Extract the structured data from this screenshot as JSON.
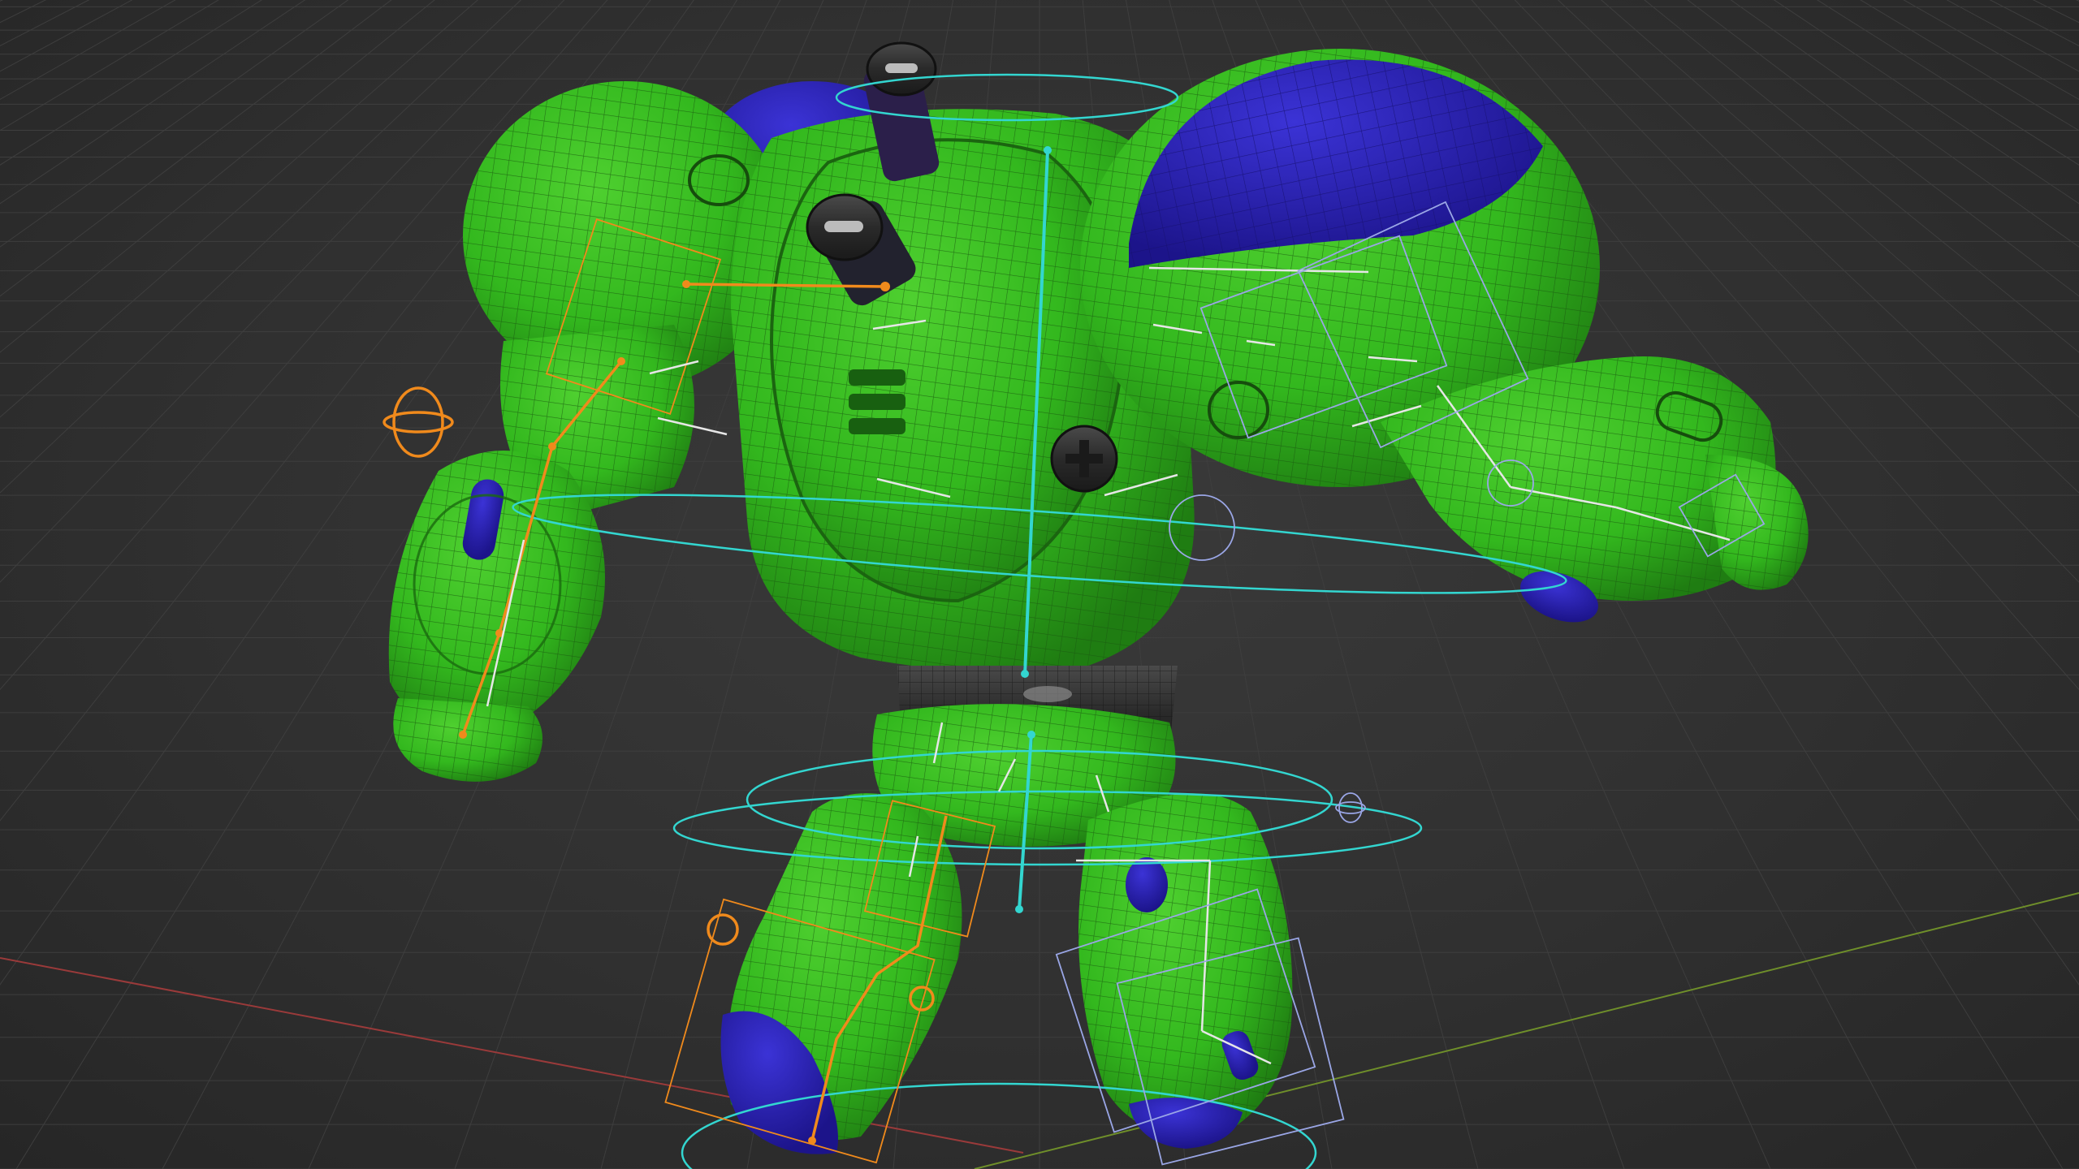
{
  "viewport": {
    "mode": "3d-viewport",
    "overlays": {
      "grid": true,
      "wireframe_overlay": true,
      "armature_visible": true
    },
    "colors": {
      "background": "#303030",
      "grid_line": "#3e3e3e",
      "x_axis": "#9a3a3a",
      "y_axis": "#6f8f2a",
      "mesh_body": "#33b81e",
      "mesh_wire": "#1a5a10",
      "mesh_accent": "#2a1fb3",
      "mesh_dark": "#2b2b2b",
      "bone_orange": "#f08a1c",
      "bone_white": "#e6e6e6",
      "control_cyan": "#33d6d0",
      "control_lilac": "#9aa6e6"
    }
  }
}
